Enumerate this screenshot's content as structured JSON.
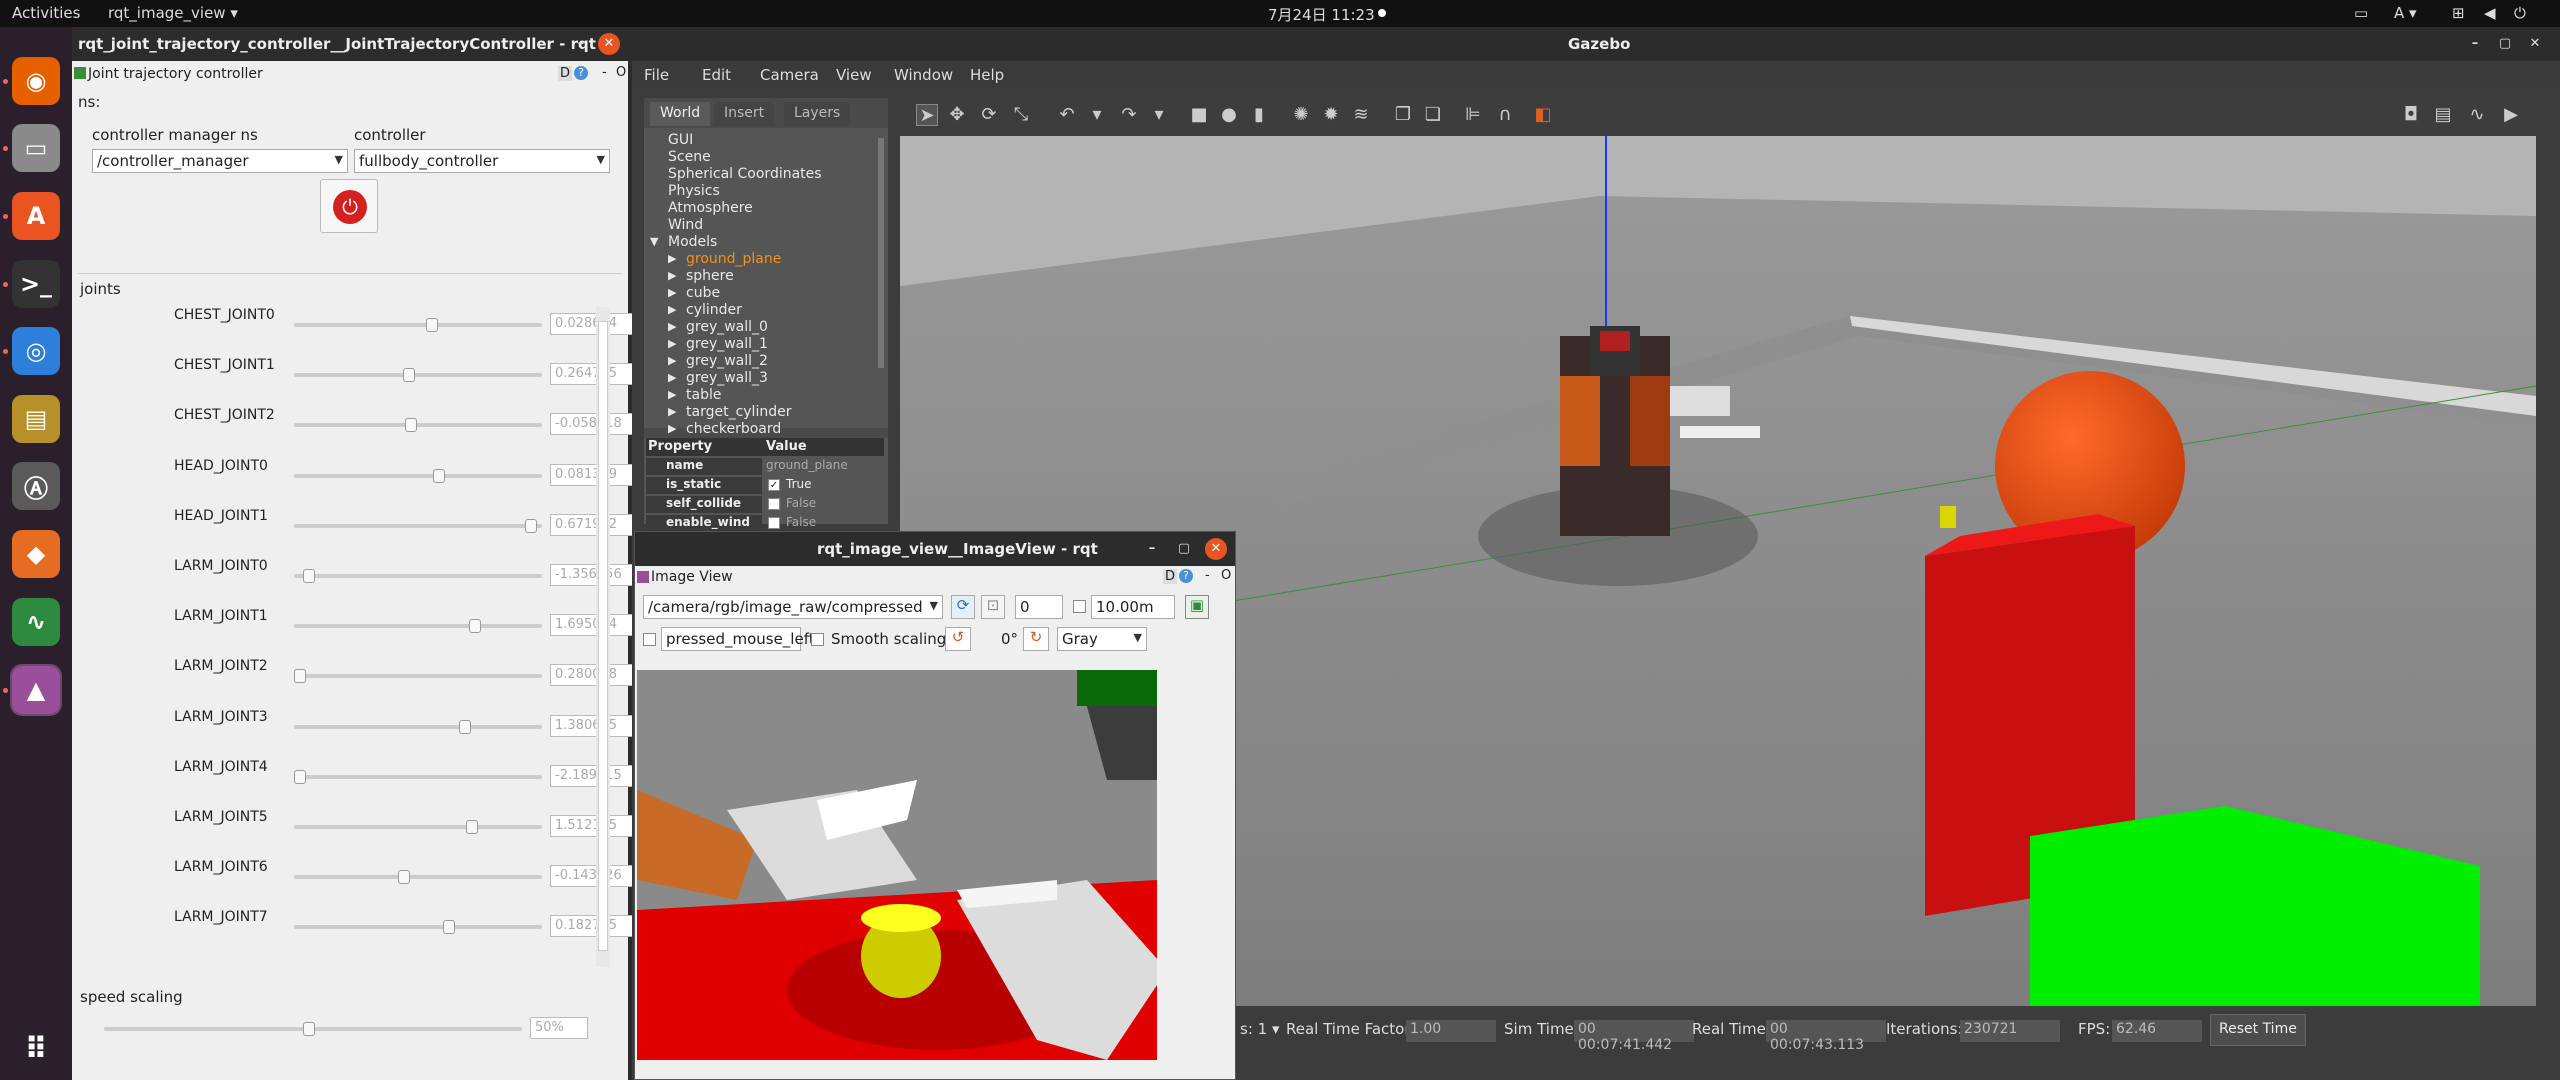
{
  "topbar": {
    "activities": "Activities",
    "app_menu": "rqt_image_view ▾",
    "clock": "7月24日  11:23",
    "input_indicator": "A ▾"
  },
  "dock": {
    "apps": [
      {
        "name": "firefox",
        "glyph": "◉",
        "color": "#e66000"
      },
      {
        "name": "files",
        "glyph": "▭",
        "color": "#8a8a8a"
      },
      {
        "name": "software",
        "glyph": "A",
        "color": "#e95420"
      },
      {
        "name": "terminal",
        "glyph": ">_",
        "color": "#333"
      },
      {
        "name": "chrome",
        "glyph": "◎",
        "color": "#2d7fd9"
      },
      {
        "name": "archive",
        "glyph": "▤",
        "color": "#b8902a"
      },
      {
        "name": "software-updater",
        "glyph": "Ⓐ",
        "color": "#5a5a5a"
      },
      {
        "name": "layers-app",
        "glyph": "◆",
        "color": "#e56c20"
      },
      {
        "name": "system-monitor",
        "glyph": "∿",
        "color": "#2d8a3e"
      },
      {
        "name": "image-viewer",
        "glyph": "▲",
        "color": "#9a4f9a"
      }
    ],
    "grid_glyph": "⠿"
  },
  "jtc": {
    "title": "rqt_joint_trajectory_controller__JointTrajectoryController - rqt",
    "plugin_title": "Joint trajectory controller",
    "ns_label": "ns:",
    "cm_label": "controller manager ns",
    "controller_label": "controller",
    "cm_value": "/controller_manager",
    "controller_value": "fullbody_controller",
    "joints_label": "joints",
    "joints": [
      {
        "name": "CHEST_JOINT0",
        "value": "0.028694",
        "pos": 0.56
      },
      {
        "name": "CHEST_JOINT1",
        "value": "0.264725",
        "pos": 0.46
      },
      {
        "name": "CHEST_JOINT2",
        "value": "-0.058018",
        "pos": 0.47
      },
      {
        "name": "HEAD_JOINT0",
        "value": "0.081329",
        "pos": 0.59
      },
      {
        "name": "HEAD_JOINT1",
        "value": "0.671952",
        "pos": 0.98
      },
      {
        "name": "LARM_JOINT0",
        "value": "-1.356456",
        "pos": 0.04
      },
      {
        "name": "LARM_JOINT1",
        "value": "1.695004",
        "pos": 0.74
      },
      {
        "name": "LARM_JOINT2",
        "value": "0.280058",
        "pos": 0.0
      },
      {
        "name": "LARM_JOINT3",
        "value": "1.380645",
        "pos": 0.7
      },
      {
        "name": "LARM_JOINT4",
        "value": "-2.189915",
        "pos": 0.0
      },
      {
        "name": "LARM_JOINT5",
        "value": "1.512125",
        "pos": 0.73
      },
      {
        "name": "LARM_JOINT6",
        "value": "-0.143526",
        "pos": 0.44
      },
      {
        "name": "LARM_JOINT7",
        "value": "0.182705",
        "pos": 0.63
      }
    ],
    "speed_label": "speed scaling",
    "speed_value": "50%",
    "speed_pos": 0.49
  },
  "gazebo": {
    "title": "Gazebo",
    "menus": [
      "File",
      "Edit",
      "Camera",
      "View",
      "Window",
      "Help"
    ],
    "tabs": [
      "World",
      "Insert",
      "Layers"
    ],
    "tree": [
      "GUI",
      "Scene",
      "Spherical Coordinates",
      "Physics",
      "Atmosphere",
      "Wind"
    ],
    "models_label": "Models",
    "models": [
      "ground_plane",
      "sphere",
      "cube",
      "cylinder",
      "grey_wall_0",
      "grey_wall_1",
      "grey_wall_2",
      "grey_wall_3",
      "table",
      "target_cylinder",
      "checkerboard"
    ],
    "prop_header": [
      "Property",
      "Value"
    ],
    "props": [
      {
        "k": "name",
        "v": "ground_plane"
      },
      {
        "k": "is_static",
        "v": "True",
        "checked": true
      },
      {
        "k": "self_collide",
        "v": "False",
        "checked": false
      },
      {
        "k": "enable_wind",
        "v": "False",
        "checked": false
      }
    ],
    "footer": {
      "steps": "s: 1 ▾",
      "rtf_label": "Real Time Factor:",
      "rtf": "1.00",
      "sim_label": "Sim Time:",
      "sim": "00 00:07:41.442",
      "real_label": "Real Time:",
      "real": "00 00:07:43.113",
      "iter_label": "Iterations:",
      "iter": "230721",
      "fps_label": "FPS:",
      "fps": "62.46",
      "reset": "Reset Time"
    }
  },
  "imageview": {
    "title": "rqt_image_view__ImageView - rqt",
    "plugin_title": "Image View",
    "topic": "/camera/rgb/image_raw/compressed",
    "spin": "0",
    "max": "10.00m",
    "mouse_topic": "pressed_mouse_left",
    "smooth": "Smooth scaling",
    "rotation": "0°",
    "colormap": "Gray"
  }
}
